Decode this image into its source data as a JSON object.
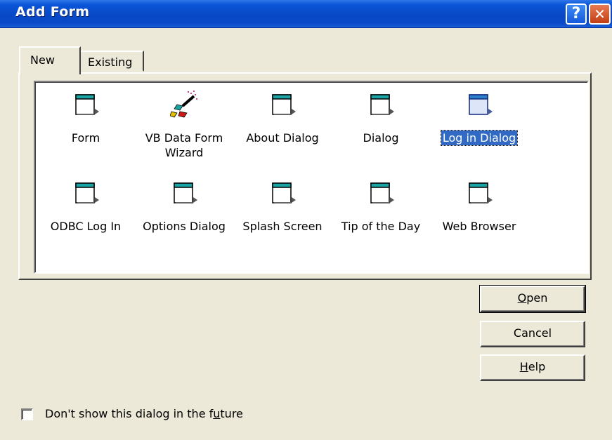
{
  "window": {
    "title": "Add Form",
    "help_glyph": "?",
    "close_glyph": "✕"
  },
  "tabs": [
    {
      "label": "New",
      "selected": true
    },
    {
      "label": "Existing",
      "selected": false
    }
  ],
  "items": [
    {
      "label": "Form",
      "icon": "form-icon"
    },
    {
      "label": "VB Data Form Wizard",
      "icon": "wizard-icon"
    },
    {
      "label": "About Dialog",
      "icon": "form-icon"
    },
    {
      "label": "Dialog",
      "icon": "form-icon"
    },
    {
      "label": "Log in Dialog",
      "icon": "form-icon",
      "selected": true
    },
    {
      "label": "ODBC Log In",
      "icon": "form-icon"
    },
    {
      "label": "Options Dialog",
      "icon": "form-icon"
    },
    {
      "label": "Splash Screen",
      "icon": "form-icon"
    },
    {
      "label": "Tip of the Day",
      "icon": "form-icon"
    },
    {
      "label": "Web Browser",
      "icon": "form-icon"
    }
  ],
  "buttons": {
    "open": {
      "pre": "",
      "key": "O",
      "post": "pen"
    },
    "cancel": {
      "label": "Cancel"
    },
    "help": {
      "pre": "",
      "key": "H",
      "post": "elp"
    }
  },
  "checkbox": {
    "label_pre": "Don't show this dialog in the f",
    "label_key": "u",
    "label_post": "ture",
    "checked": false
  },
  "colors": {
    "title_bar": "#0a55d8",
    "selection": "#316ac5",
    "dialog_bg": "#ece9d8"
  }
}
